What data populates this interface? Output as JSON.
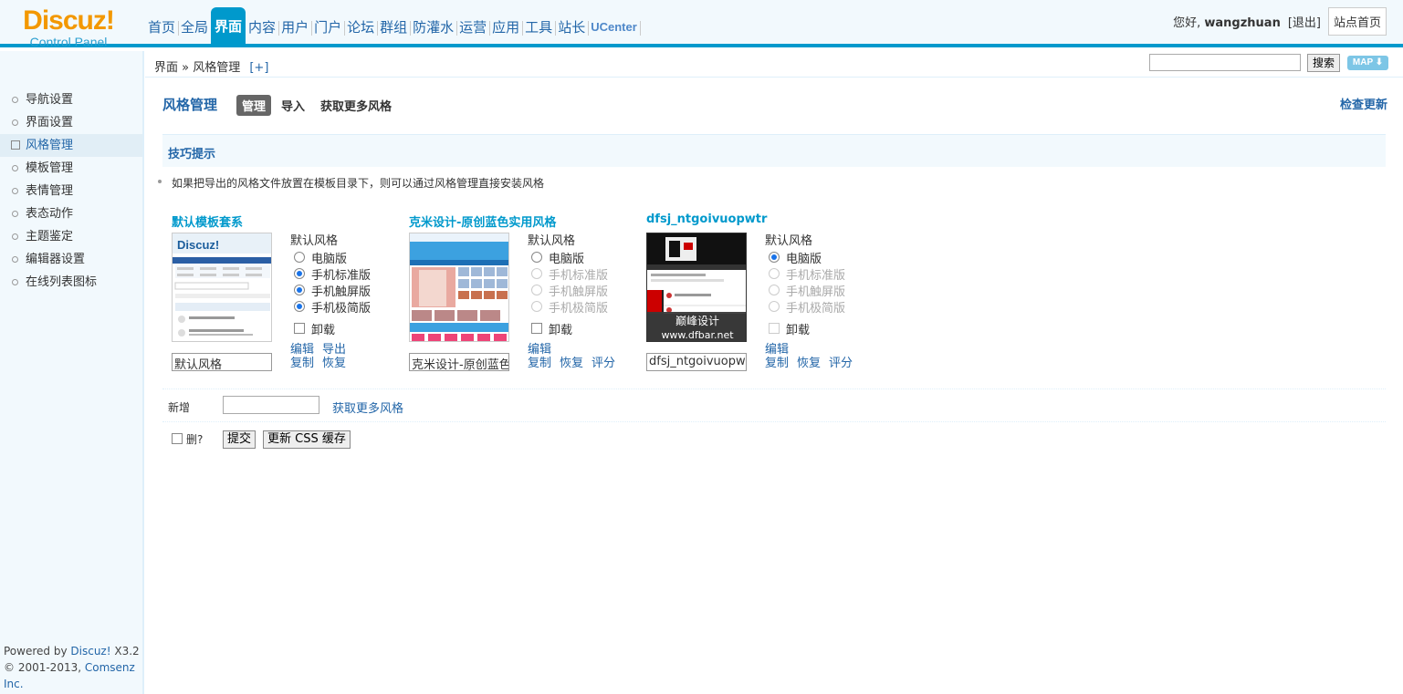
{
  "header": {
    "logo_brand": "Discuz!",
    "logo_sub": "Control Panel",
    "nav": [
      "首页",
      "全局",
      "界面",
      "内容",
      "用户",
      "门户",
      "论坛",
      "群组",
      "防灌水",
      "运营",
      "应用",
      "工具",
      "站长",
      "UCenter"
    ],
    "active_nav": "界面",
    "greeting": "您好,",
    "username": "wangzhuan",
    "logout": "[退出]",
    "site_home": "站点首页"
  },
  "breadcrumb": {
    "path": "界面 » 风格管理",
    "add": "[+]",
    "search_button": "搜索",
    "map_button": "MAP ⬇"
  },
  "sidebar": {
    "items": [
      "导航设置",
      "界面设置",
      "风格管理",
      "模板管理",
      "表情管理",
      "表态动作",
      "主题鉴定",
      "编辑器设置",
      "在线列表图标"
    ],
    "active": "风格管理"
  },
  "footer": {
    "powered_prefix": "Powered by",
    "powered_name": "Discuz!",
    "version": "X3.2",
    "copyright_prefix": "© 2001-2013,",
    "company": "Comsenz Inc."
  },
  "page": {
    "title": "风格管理",
    "tabs": [
      "管理",
      "导入",
      "获取更多风格"
    ],
    "check_update": "检查更新",
    "tips_title": "技巧提示",
    "tip": "如果把导出的风格文件放置在模板目录下，则可以通过风格管理直接安装风格"
  },
  "styles": [
    {
      "name": "默认模板套系",
      "default_label": "默认风格",
      "options": [
        "电脑版",
        "手机标准版",
        "手机触屏版",
        "手机极简版"
      ],
      "uninstall": "卸载",
      "field_value": "默认风格",
      "links_row1": [
        "编辑",
        "导出"
      ],
      "links_row2": [
        "复制",
        "恢复"
      ],
      "thumb_text": "Discuz!"
    },
    {
      "name": "克米设计-原创蓝色实用风格",
      "default_label": "默认风格",
      "options": [
        "电脑版",
        "手机标准版",
        "手机触屏版",
        "手机极简版"
      ],
      "uninstall": "卸载",
      "field_value": "克米设计-原创蓝色实",
      "links_row1": [
        "编辑"
      ],
      "links_row2": [
        "复制",
        "恢复",
        "评分"
      ]
    },
    {
      "name": "dfsj_ntgoivuopwtr",
      "default_label": "默认风格",
      "options": [
        "电脑版",
        "手机标准版",
        "手机触屏版",
        "手机极简版"
      ],
      "uninstall": "卸载",
      "field_value": "dfsj_ntgoivuopw",
      "links_row1": [
        "编辑"
      ],
      "links_row2": [
        "复制",
        "恢复",
        "评分"
      ],
      "thumb_caption1": "巅峰设计",
      "thumb_caption2": "www.dfbar.net"
    }
  ],
  "new_row": {
    "label": "新增",
    "more": "获取更多风格"
  },
  "actions": {
    "delete": "删?",
    "submit": "提交",
    "update_css": "更新 CSS 缓存"
  }
}
